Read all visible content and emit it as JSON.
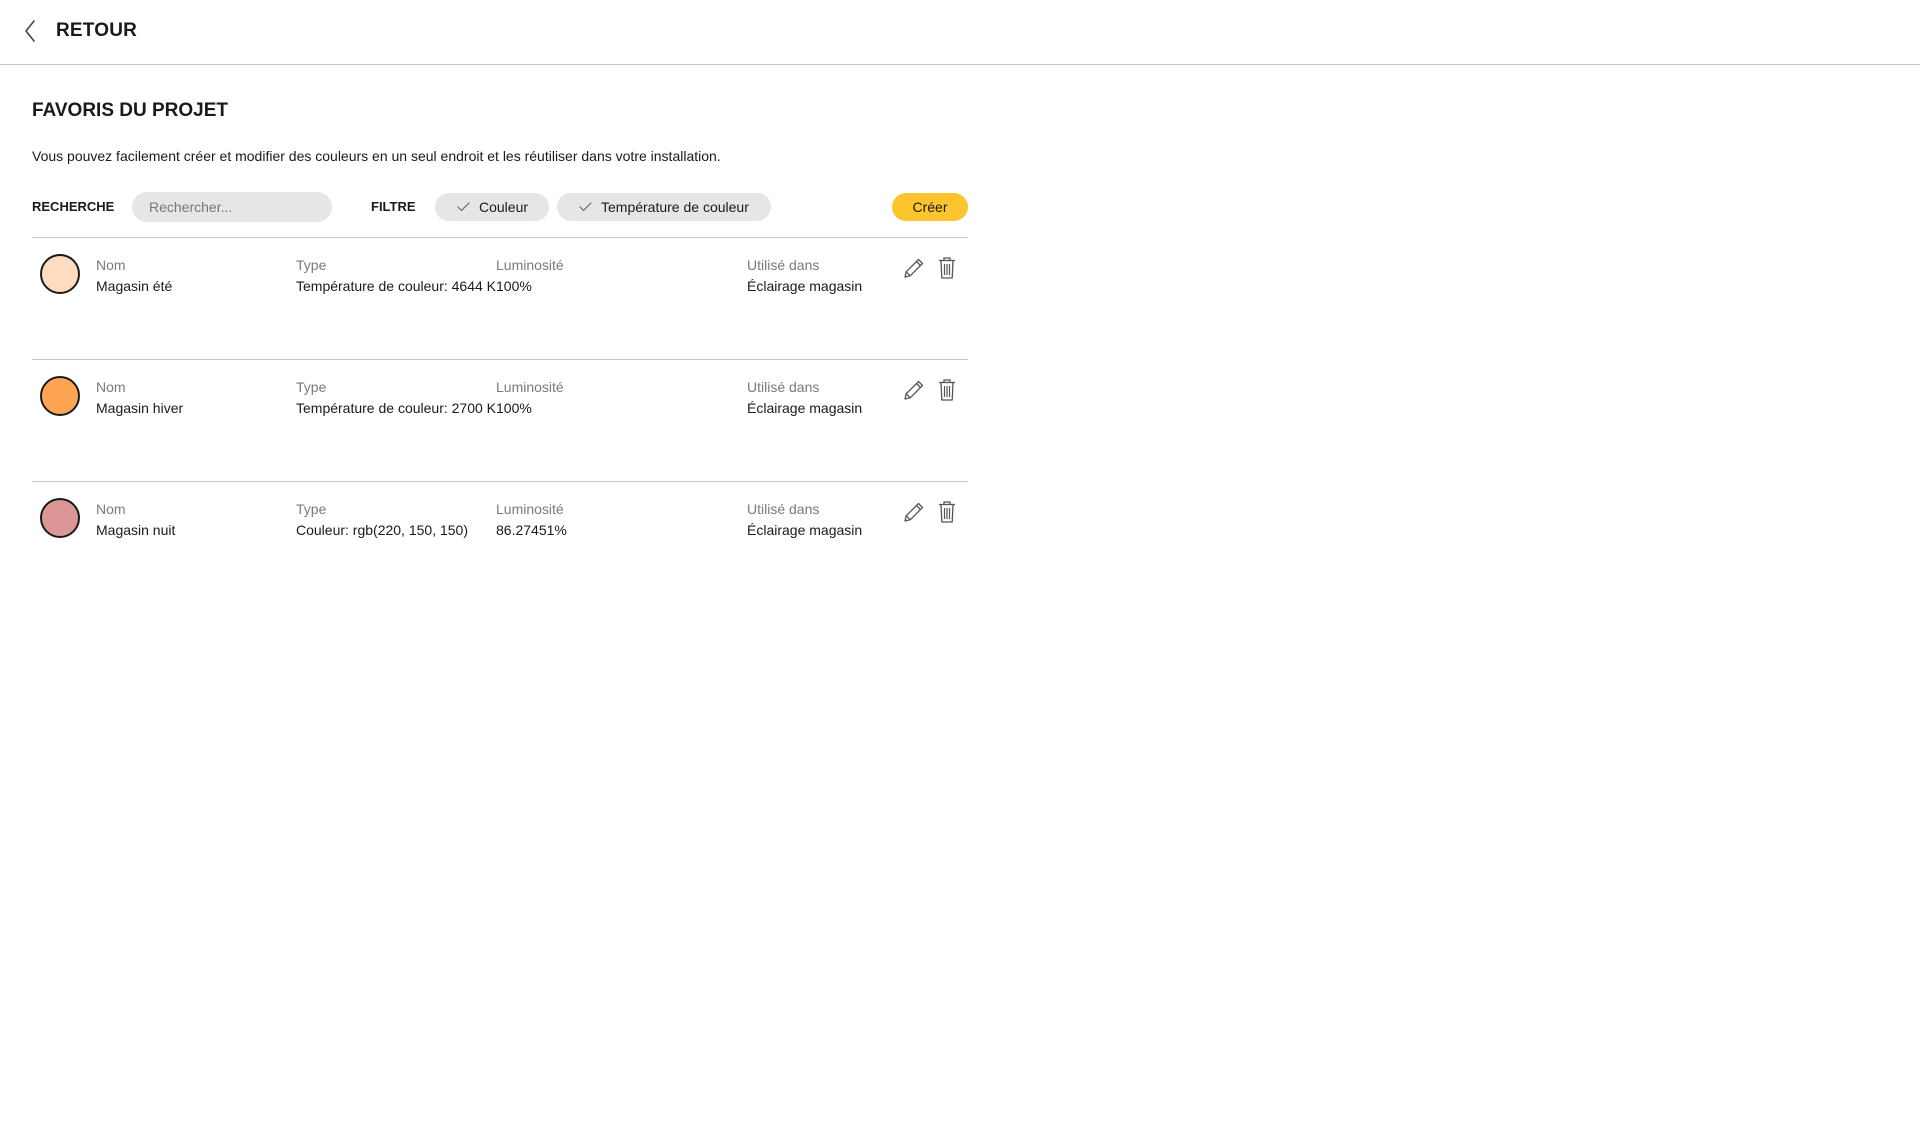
{
  "header": {
    "back_label": "RETOUR"
  },
  "page": {
    "title": "FAVORIS DU PROJET",
    "description": "Vous pouvez facilement créer et modifier des couleurs en un seul endroit et les réutiliser dans votre installation."
  },
  "toolbar": {
    "search_label": "RECHERCHE",
    "search_placeholder": "Rechercher...",
    "search_value": "",
    "filter_label": "FILTRE",
    "filters": [
      {
        "label": "Couleur",
        "checked": true
      },
      {
        "label": "Température de couleur",
        "checked": true
      }
    ],
    "create_label": "Créer"
  },
  "columns": {
    "name": "Nom",
    "type": "Type",
    "luminosity": "Luminosité",
    "used_in": "Utilisé dans"
  },
  "favorites": [
    {
      "color": "#ffdcc0",
      "name": "Magasin été",
      "type": "Température de couleur: 4644 K",
      "luminosity": "100%",
      "used_in": "Éclairage magasin"
    },
    {
      "color": "#ffa452",
      "name": "Magasin hiver",
      "type": "Température de couleur: 2700 K",
      "luminosity": "100%",
      "used_in": "Éclairage magasin"
    },
    {
      "color": "#dc9696",
      "name": "Magasin nuit",
      "type": "Couleur: rgb(220, 150, 150)",
      "luminosity": "86.27451%",
      "used_in": "Éclairage magasin"
    }
  ],
  "icons": {
    "back": "chevron-left-icon",
    "check": "check-icon",
    "edit": "pencil-icon",
    "delete": "trash-icon"
  },
  "colors": {
    "accent": "#fcc42d",
    "chip_background": "#e6e6e6",
    "divider": "#c8c8c8",
    "muted_text": "#7a7a7a"
  }
}
